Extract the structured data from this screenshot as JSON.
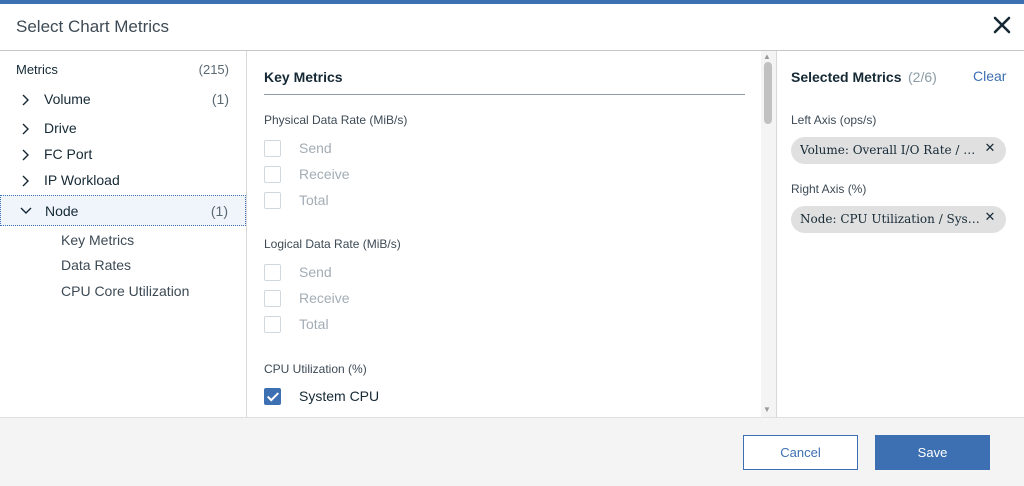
{
  "dialog": {
    "title": "Select Chart Metrics"
  },
  "left": {
    "header": "Metrics",
    "count": "(215)",
    "items": [
      {
        "label": "Volume",
        "count": "(1)",
        "expanded": false
      },
      {
        "label": "Drive",
        "count": "",
        "expanded": false
      },
      {
        "label": "FC Port",
        "count": "",
        "expanded": false
      },
      {
        "label": "IP Workload",
        "count": "",
        "expanded": false
      },
      {
        "label": "Node",
        "count": "(1)",
        "expanded": true
      }
    ],
    "subitems": [
      "Key Metrics",
      "Data Rates",
      "CPU Core Utilization"
    ]
  },
  "middle": {
    "header": "Key Metrics",
    "groups": [
      {
        "label": "Physical Data Rate (MiB/s)",
        "options": [
          {
            "label": "Send",
            "checked": false
          },
          {
            "label": "Receive",
            "checked": false
          },
          {
            "label": "Total",
            "checked": false
          }
        ]
      },
      {
        "label": "Logical Data Rate (MiB/s)",
        "options": [
          {
            "label": "Send",
            "checked": false
          },
          {
            "label": "Receive",
            "checked": false
          },
          {
            "label": "Total",
            "checked": false
          }
        ]
      },
      {
        "label": "CPU Utilization (%)",
        "options": [
          {
            "label": "System CPU",
            "checked": true
          }
        ]
      }
    ]
  },
  "right": {
    "header": "Selected Metrics",
    "count": "(2/6)",
    "clear_label": "Clear",
    "axes": [
      {
        "label": "Left Axis (ops/s)",
        "pill": "Volume: Overall I/O Rate / Total"
      },
      {
        "label": "Right Axis (%)",
        "pill": "Node: CPU Utilization / System CPU"
      }
    ]
  },
  "footer": {
    "cancel_label": "Cancel",
    "save_label": "Save"
  },
  "colors": {
    "accent": "#3d70b2",
    "pill_bg": "#e0e0e0",
    "footer_bg": "#f4f4f4"
  },
  "icons": {
    "close": "close-icon",
    "collapsed": "chevron-right-icon",
    "expanded": "chevron-down-icon",
    "remove": "remove-icon"
  }
}
